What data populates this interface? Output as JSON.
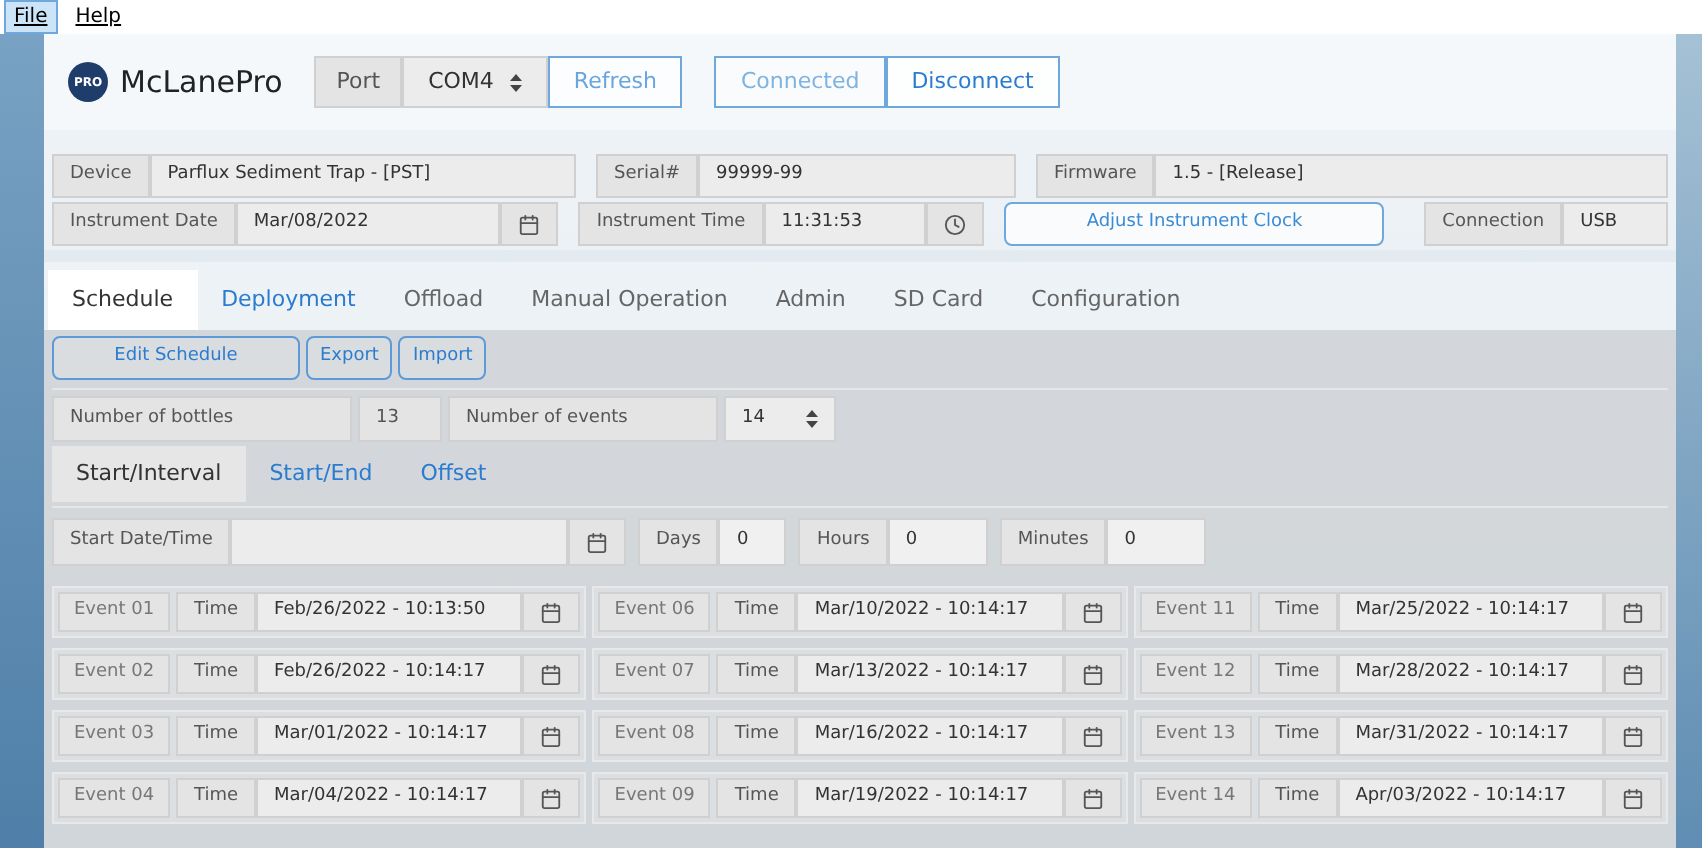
{
  "menu": [
    {
      "label": "File",
      "selected": true
    },
    {
      "label": "Help",
      "selected": false
    }
  ],
  "header": {
    "logo_badge": "PRO",
    "logo_text": "McLanePro",
    "port_label": "Port",
    "port_value": "COM4",
    "refresh": "Refresh",
    "connection_buttons": [
      {
        "label": "Connected",
        "disabled": true
      },
      {
        "label": "Disconnect",
        "disabled": false
      }
    ]
  },
  "info_rows": [
    [
      {
        "label": "Device",
        "value": "Parflux Sediment Trap - [PST]"
      },
      {
        "label": "Serial#",
        "value": "99999-99"
      },
      {
        "label": "Firmware",
        "value": "1.5 - [Release]"
      }
    ],
    [
      {
        "label": "Instrument Date",
        "value": "Mar/08/2022"
      },
      {
        "label": "Instrument Time",
        "value": "11:31:53"
      },
      {
        "button": "Adjust Instrument Clock"
      },
      {
        "label": "Connection",
        "value": "USB"
      }
    ]
  ],
  "tabs": [
    {
      "label": "Schedule",
      "selected": true
    },
    {
      "label": "Deployment",
      "selected": false,
      "highlighted": true
    },
    {
      "label": "Offload",
      "selected": false
    },
    {
      "label": "Manual Operation",
      "selected": false
    },
    {
      "label": "Admin",
      "selected": false
    },
    {
      "label": "SD Card",
      "selected": false
    },
    {
      "label": "Configuration",
      "selected": false
    }
  ],
  "toolbar": [
    "Edit Schedule",
    "Export",
    "Import"
  ],
  "bottles": {
    "label": "Number of bottles",
    "value": "13"
  },
  "events_count": {
    "label": "Number of events",
    "value": "14"
  },
  "subtabs": [
    {
      "label": "Start/Interval",
      "selected": true
    },
    {
      "label": "Start/End",
      "selected": false
    },
    {
      "label": "Offset",
      "selected": false
    }
  ],
  "start": {
    "label": "Start Date/Time",
    "days_label": "Days",
    "days": "0",
    "hours_label": "Hours",
    "hours": "0",
    "minutes_label": "Minutes",
    "minutes": "0"
  },
  "event_columns": [
    [
      {
        "name": "Event 01",
        "time_label": "Time",
        "time": "Feb/26/2022 - 10:13:50"
      },
      {
        "name": "Event 02",
        "time_label": "Time",
        "time": "Feb/26/2022 - 10:14:17"
      },
      {
        "name": "Event 03",
        "time_label": "Time",
        "time": "Mar/01/2022 - 10:14:17"
      },
      {
        "name": "Event 04",
        "time_label": "Time",
        "time": "Mar/04/2022 - 10:14:17"
      }
    ],
    [
      {
        "name": "Event 06",
        "time_label": "Time",
        "time": "Mar/10/2022 - 10:14:17"
      },
      {
        "name": "Event 07",
        "time_label": "Time",
        "time": "Mar/13/2022 - 10:14:17"
      },
      {
        "name": "Event 08",
        "time_label": "Time",
        "time": "Mar/16/2022 - 10:14:17"
      },
      {
        "name": "Event 09",
        "time_label": "Time",
        "time": "Mar/19/2022 - 10:14:17"
      }
    ],
    [
      {
        "name": "Event 11",
        "time_label": "Time",
        "time": "Mar/25/2022 - 10:14:17"
      },
      {
        "name": "Event 12",
        "time_label": "Time",
        "time": "Mar/28/2022 - 10:14:17"
      },
      {
        "name": "Event 13",
        "time_label": "Time",
        "time": "Mar/31/2022 - 10:14:17"
      },
      {
        "name": "Event 14",
        "time_label": "Time",
        "time": "Apr/03/2022 - 10:14:17"
      }
    ]
  ]
}
